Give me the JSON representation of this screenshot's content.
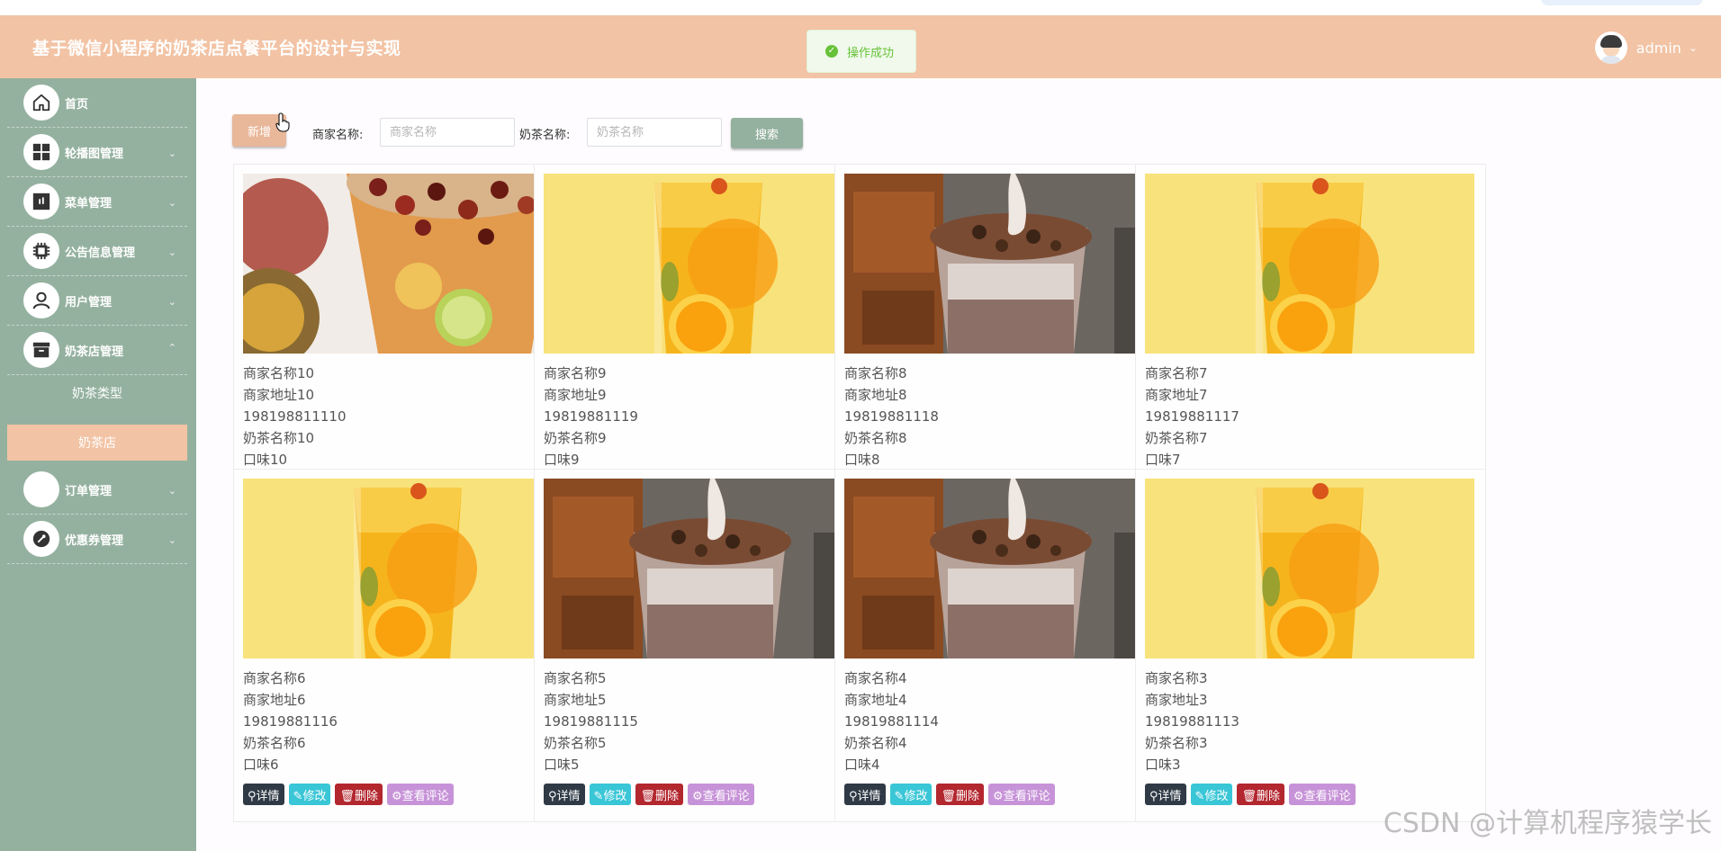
{
  "header": {
    "title": "基于微信小程序的奶茶店点餐平台的设计与实现",
    "toast": "操作成功",
    "user": "admin"
  },
  "sidebar": {
    "items": [
      {
        "label": "首页",
        "icon": "home-icon"
      },
      {
        "label": "轮播图管理",
        "icon": "grid-icon"
      },
      {
        "label": "菜单管理",
        "icon": "menu-icon"
      },
      {
        "label": "公告信息管理",
        "icon": "chip-icon"
      },
      {
        "label": "用户管理",
        "icon": "user-icon"
      },
      {
        "label": "奶茶店管理",
        "icon": "store-icon"
      },
      {
        "label": "订单管理",
        "icon": "order-icon"
      },
      {
        "label": "优惠券管理",
        "icon": "coupon-icon"
      }
    ],
    "sub_items": [
      "奶茶类型",
      "奶茶店"
    ],
    "active_sub": "奶茶店"
  },
  "toolbar": {
    "add_label": "新增",
    "merchant_label": "商家名称:",
    "merchant_placeholder": "商家名称",
    "tea_label": "奶茶名称:",
    "tea_placeholder": "奶茶名称",
    "search_label": "搜索"
  },
  "buttons": {
    "detail": "详情",
    "edit": "修改",
    "delete": "删除",
    "review": "查看评论"
  },
  "cards": [
    {
      "merchant": "商家名称10",
      "address": "商家地址10",
      "phone": "198198811110",
      "tea": "奶茶名称10",
      "flavor": "口味10",
      "image": "fruit-tea"
    },
    {
      "merchant": "商家名称9",
      "address": "商家地址9",
      "phone": "19819881119",
      "tea": "奶茶名称9",
      "flavor": "口味9",
      "image": "orange-tea"
    },
    {
      "merchant": "商家名称8",
      "address": "商家地址8",
      "phone": "19819881118",
      "tea": "奶茶名称8",
      "flavor": "口味8",
      "image": "chocolate-shake"
    },
    {
      "merchant": "商家名称7",
      "address": "商家地址7",
      "phone": "19819881117",
      "tea": "奶茶名称7",
      "flavor": "口味7",
      "image": "orange-tea"
    },
    {
      "merchant": "商家名称6",
      "address": "商家地址6",
      "phone": "19819881116",
      "tea": "奶茶名称6",
      "flavor": "口味6",
      "image": "orange-tea"
    },
    {
      "merchant": "商家名称5",
      "address": "商家地址5",
      "phone": "19819881115",
      "tea": "奶茶名称5",
      "flavor": "口味5",
      "image": "chocolate-shake"
    },
    {
      "merchant": "商家名称4",
      "address": "商家地址4",
      "phone": "19819881114",
      "tea": "奶茶名称4",
      "flavor": "口味4",
      "image": "chocolate-shake"
    },
    {
      "merchant": "商家名称3",
      "address": "商家地址3",
      "phone": "19819881113",
      "tea": "奶茶名称3",
      "flavor": "口味3",
      "image": "orange-tea"
    }
  ],
  "watermark": "CSDN @计算机程序猿学长"
}
